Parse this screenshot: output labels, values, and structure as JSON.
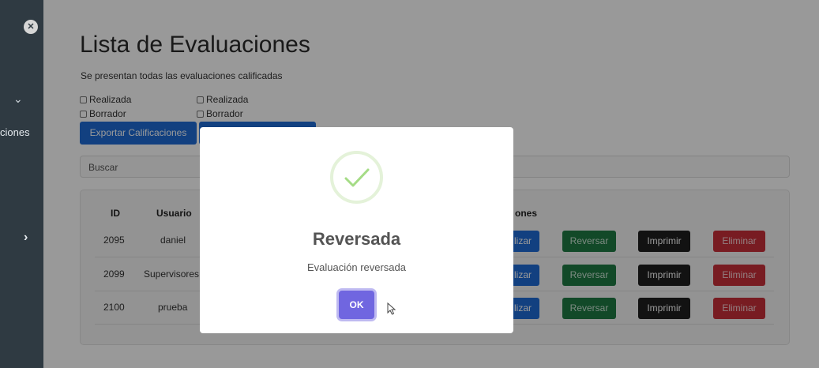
{
  "sidebar": {
    "close_icon": "close-icon",
    "nav_text": "ciones",
    "chevron_down": "chevron-down-icon",
    "chevron_right": "chevron-right-icon"
  },
  "page": {
    "title": "Lista de Evaluaciones",
    "subtitle": "Se presentan todas las evaluaciones calificadas"
  },
  "filters": {
    "col1": [
      "Realizada",
      "Borrador"
    ],
    "col2": [
      "Realizada",
      "Borrador"
    ]
  },
  "buttons": {
    "export": "Exportar Calificaciones"
  },
  "search": {
    "placeholder": "Buscar"
  },
  "table": {
    "headers": {
      "id": "ID",
      "usuario": "Usuario",
      "acciones": "ones"
    },
    "rows": [
      {
        "id": "2095",
        "usuario": "daniel"
      },
      {
        "id": "2099",
        "usuario": "Supervisores"
      },
      {
        "id": "2100",
        "usuario": "prueba"
      }
    ],
    "actions": {
      "finalizar": "lizar",
      "reversar": "Reversar",
      "imprimir": "Imprimir",
      "eliminar": "Eliminar"
    }
  },
  "modal": {
    "title": "Reversada",
    "message": "Evaluación reversada",
    "ok": "OK",
    "icon": "success-check-icon"
  },
  "colors": {
    "sidebar": "#2f3a42",
    "primary": "#1f6bd6",
    "success": "#1f7a44",
    "dark": "#1e1e1e",
    "danger": "#c8303a",
    "confirm": "#7066e0",
    "check": "#a5dc86"
  }
}
